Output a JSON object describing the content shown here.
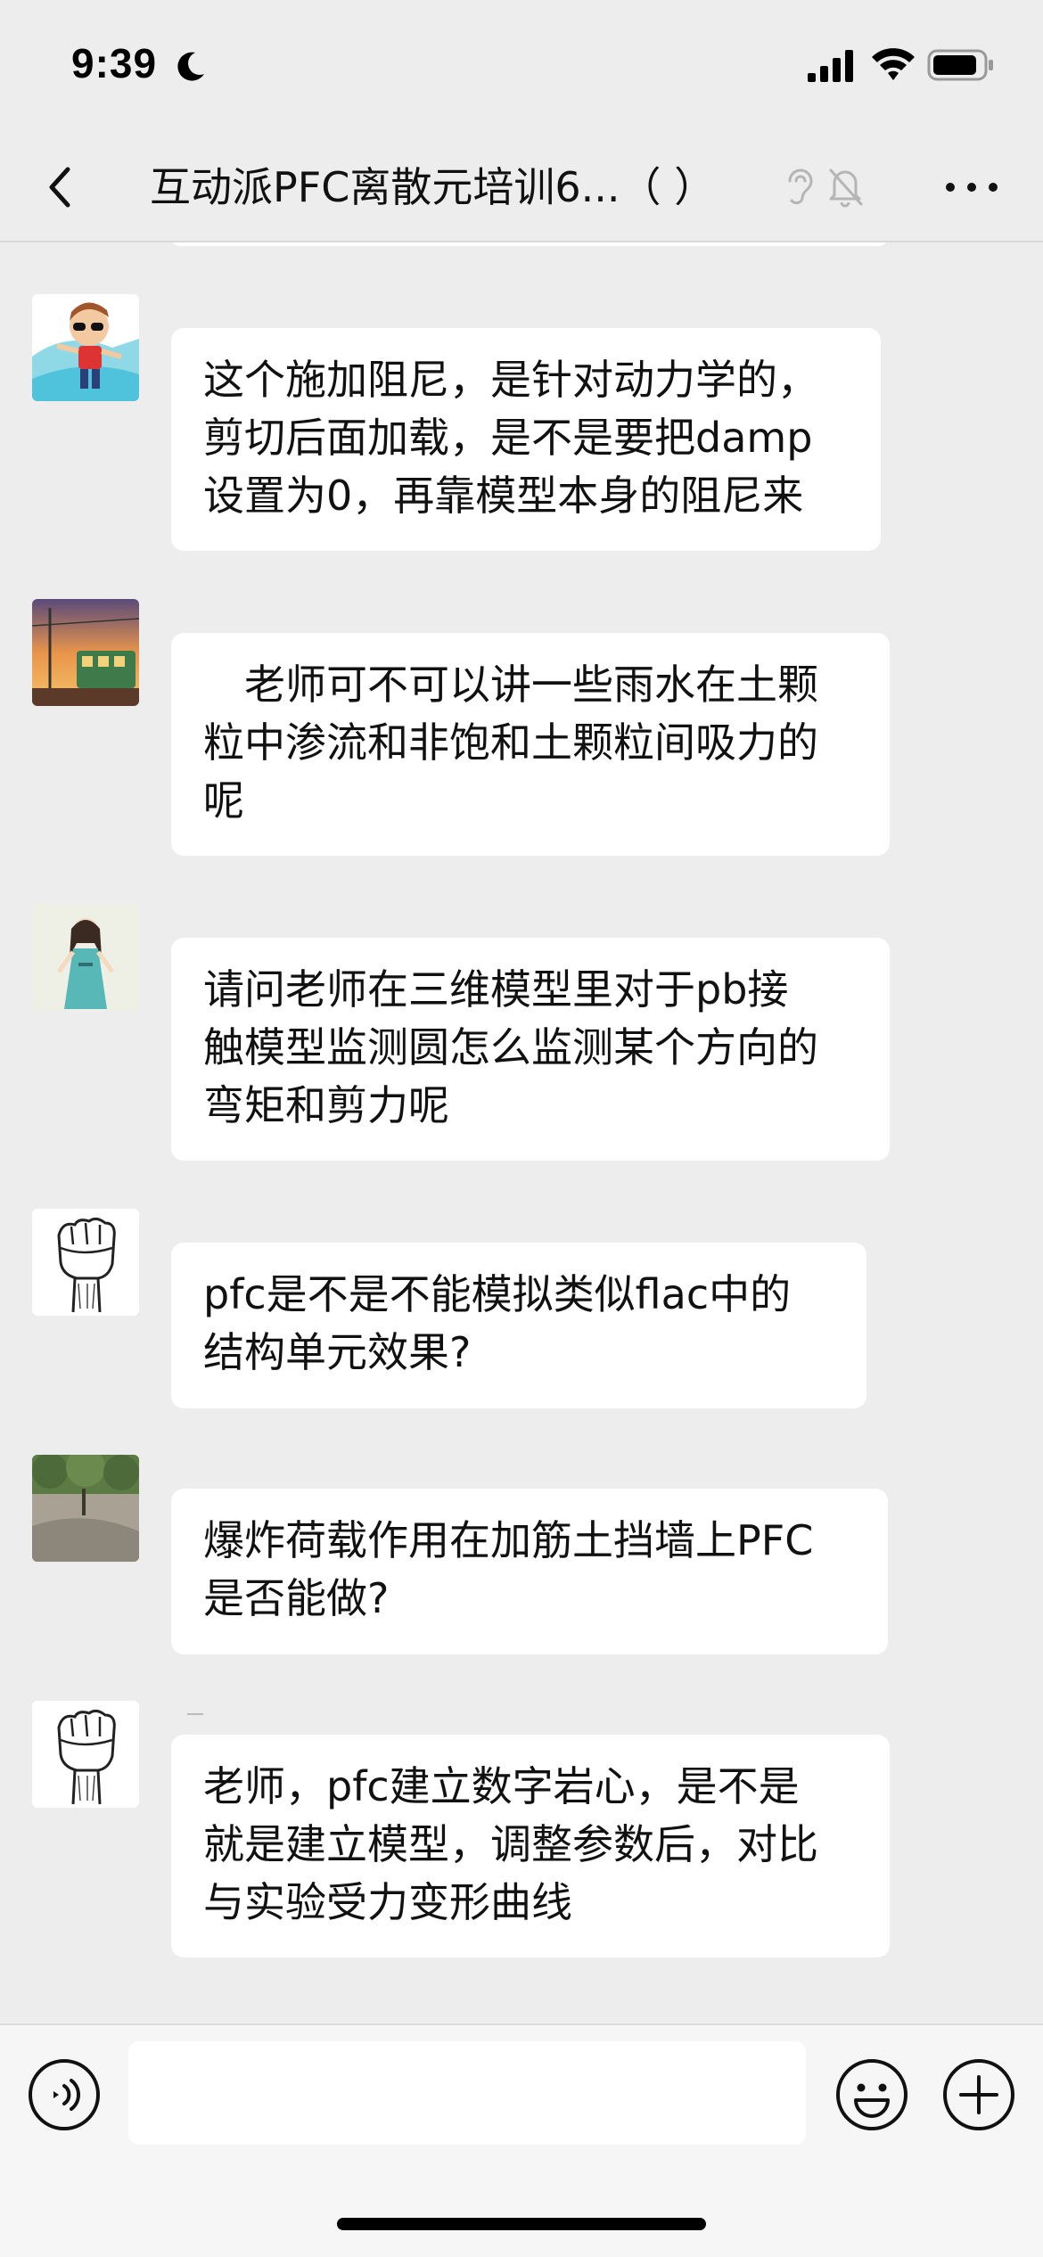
{
  "status_bar": {
    "time": "9:39",
    "icons": [
      "moon-icon",
      "signal-icon",
      "wifi-icon",
      "battery-icon"
    ]
  },
  "nav": {
    "title": "互动派PFC离散元培训6...（    ）",
    "icons": [
      "back-icon",
      "ear-icon",
      "mute-bell-icon",
      "more-icon"
    ]
  },
  "messages": [
    {
      "avatar": "cartoon-boy-avatar",
      "text": "这个施加阻尼，是针对动力学的，\n剪切后面加载，是不是要把damp\n设置为0，再靠模型本身的阻尼来"
    },
    {
      "avatar": "sunset-train-avatar",
      "text": "　老师可不可以讲一些雨水在土颗\n粒中渗流和非饱和土颗粒间吸力的\n呢"
    },
    {
      "avatar": "girl-illustration-avatar",
      "text": "请问老师在三维模型里对于pb接\n触模型监测圆怎么监测某个方向的\n弯矩和剪力呢"
    },
    {
      "avatar": "fist-sketch-avatar",
      "text": "pfc是不是不能模拟类似flac中的\n结构单元效果?"
    },
    {
      "avatar": "park-photo-avatar",
      "text": "爆炸荷载作用在加筋土挡墙上PFC\n是否能做?"
    },
    {
      "avatar": "fist-sketch-avatar",
      "text": "老师，pfc建立数字岩心，是不是\n就是建立模型，调整参数后，对比\n与实验受力变形曲线"
    }
  ],
  "input_bar": {
    "value": "",
    "icons": [
      "voice-icon",
      "emoji-icon",
      "plus-icon"
    ]
  },
  "colors": {
    "background": "#ededed",
    "bubble": "#ffffff",
    "input_bar": "#f6f6f6",
    "text": "#111111"
  }
}
